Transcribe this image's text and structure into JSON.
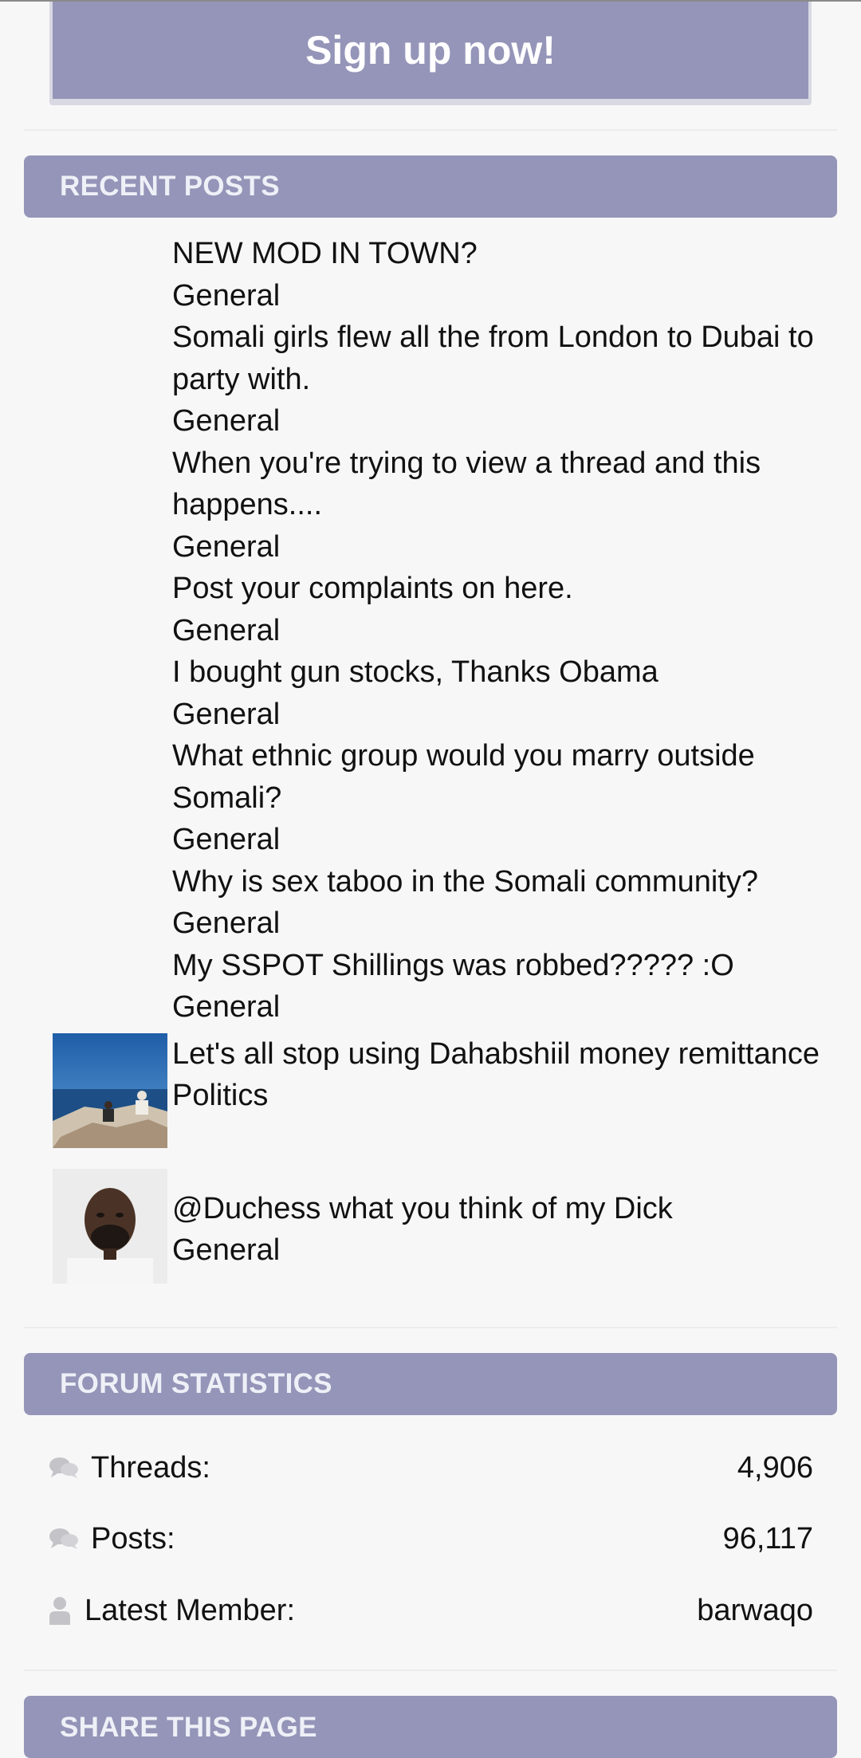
{
  "signup": {
    "label": "Sign up now!"
  },
  "recent_posts": {
    "header": "RECENT POSTS",
    "items": [
      {
        "title": "NEW MOD IN TOWN?",
        "forum": "General",
        "avatar": "none"
      },
      {
        "title": "Somali girls flew all the from London to Dubai to party with.",
        "forum": "General",
        "avatar": "none"
      },
      {
        "title": "When you're trying to view a thread and this happens....",
        "forum": "General",
        "avatar": "none"
      },
      {
        "title": "Post your complaints on here.",
        "forum": "General",
        "avatar": "none"
      },
      {
        "title": "I bought gun stocks, Thanks Obama",
        "forum": "General",
        "avatar": "none"
      },
      {
        "title": "What ethnic group would you marry outside Somali?",
        "forum": "General",
        "avatar": "none"
      },
      {
        "title": "Why is sex taboo in the Somali community?",
        "forum": "General",
        "avatar": "none"
      },
      {
        "title": "My SSPOT Shillings was robbed????? :O",
        "forum": "General",
        "avatar": "none"
      },
      {
        "title": "Let's all stop using Dahabshiil money remittance",
        "forum": "Politics",
        "avatar": "seaside-photo"
      },
      {
        "title": "@Duchess what you think of my Dick",
        "forum": "General",
        "avatar": "mugshot-photo"
      }
    ]
  },
  "forum_statistics": {
    "header": "FORUM STATISTICS",
    "threads_label": "Threads:",
    "threads_value": "4,906",
    "posts_label": "Posts:",
    "posts_value": "96,117",
    "latest_member_label": "Latest Member:",
    "latest_member_value": "barwaqo"
  },
  "share": {
    "header": "SHARE THIS PAGE"
  },
  "colors": {
    "accent": "#9495b8",
    "header_text": "#eef0f7",
    "background": "#f7f7f8",
    "icon_gray": "#c4c4c8"
  },
  "icons": {
    "threads": "speech-bubbles-icon",
    "posts": "speech-bubbles-icon",
    "latest_member": "user-icon"
  }
}
